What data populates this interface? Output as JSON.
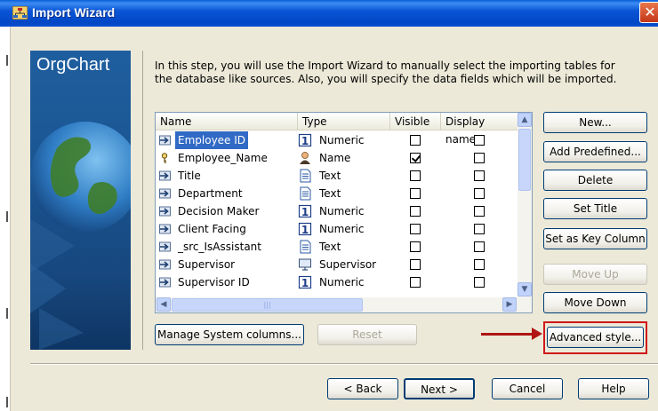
{
  "window": {
    "title": "Import Wizard",
    "close_glyph": "✕",
    "icon": "org-chart-app-icon"
  },
  "sidebar": {
    "title": "OrgChart"
  },
  "instructions": "In this step, you will use the Import Wizard to manually select the importing tables for the database like sources. Also, you will specify the data fields which will be imported.",
  "grid": {
    "columns": [
      "Name",
      "Type",
      "Visible",
      "Display name"
    ],
    "rows": [
      {
        "name": "Employee ID",
        "icon": "field-icon",
        "type": "Numeric",
        "type_icon": "numeric-icon",
        "visible": false,
        "display_name": false,
        "selected": true
      },
      {
        "name": "Employee_Name",
        "icon": "key-icon",
        "type": "Name",
        "type_icon": "person-icon",
        "visible": true,
        "display_name": false,
        "selected": false
      },
      {
        "name": "Title",
        "icon": "field-icon",
        "type": "Text",
        "type_icon": "text-icon",
        "visible": false,
        "display_name": false,
        "selected": false
      },
      {
        "name": "Department",
        "icon": "field-icon",
        "type": "Text",
        "type_icon": "text-icon",
        "visible": false,
        "display_name": false,
        "selected": false
      },
      {
        "name": "Decision Maker",
        "icon": "field-icon",
        "type": "Numeric",
        "type_icon": "numeric-icon",
        "visible": false,
        "display_name": false,
        "selected": false
      },
      {
        "name": "Client Facing",
        "icon": "field-icon",
        "type": "Numeric",
        "type_icon": "numeric-icon",
        "visible": false,
        "display_name": false,
        "selected": false
      },
      {
        "name": "_src_IsAssistant",
        "icon": "field-icon",
        "type": "Text",
        "type_icon": "text-icon",
        "visible": false,
        "display_name": false,
        "selected": false
      },
      {
        "name": "Supervisor",
        "icon": "field-icon",
        "type": "Supervisor",
        "type_icon": "monitor-icon",
        "visible": false,
        "display_name": false,
        "selected": false
      },
      {
        "name": "Supervisor ID",
        "icon": "field-icon",
        "type": "Numeric",
        "type_icon": "numeric-icon",
        "visible": false,
        "display_name": false,
        "selected": false
      }
    ]
  },
  "buttons": {
    "new": "New...",
    "add_predefined": "Add Predefined...",
    "delete": "Delete",
    "set_title": "Set Title",
    "set_key_column": "Set as Key Column",
    "move_up": "Move Up",
    "move_down": "Move Down",
    "advanced_style": "Advanced style...",
    "manage_system_columns": "Manage System columns...",
    "reset": "Reset",
    "back": "< Back",
    "next": "Next >",
    "cancel": "Cancel",
    "help": "Help"
  },
  "colors": {
    "titlebar": "#0a56d6",
    "selection": "#316ac5",
    "highlight_annotation": "#d01818",
    "sidebar": "#1a5591"
  }
}
